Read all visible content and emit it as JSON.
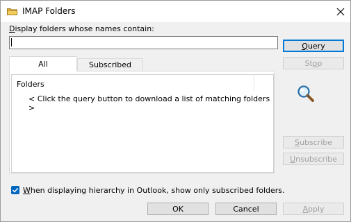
{
  "window": {
    "title": "IMAP Folders",
    "close_label": "×"
  },
  "filter": {
    "label_mnemonic": "D",
    "label_rest": "isplay folders whose names contain:",
    "value": ""
  },
  "tabs": [
    {
      "label": "All",
      "selected": true
    },
    {
      "label": "Subscribed",
      "selected": false
    }
  ],
  "list": {
    "column_header": "Folders",
    "message": "< Click the query button to download a list of matching folders >"
  },
  "buttons": {
    "query": {
      "mnemonic": "Q",
      "rest": "uery",
      "enabled": true
    },
    "stop": {
      "pre": "St",
      "mnemonic": "o",
      "rest": "p",
      "enabled": false
    },
    "subscribe": {
      "mnemonic": "S",
      "rest": "ubscribe",
      "enabled": false
    },
    "unsubscribe": {
      "mnemonic": "U",
      "rest": "nsubscribe",
      "enabled": false
    },
    "ok": {
      "label": "OK",
      "enabled": true
    },
    "cancel": {
      "label": "Cancel",
      "enabled": true
    },
    "apply": {
      "mnemonic": "A",
      "rest": "pply",
      "enabled": false
    }
  },
  "option": {
    "checked": true,
    "label_mnemonic": "W",
    "label_rest": "hen displaying hierarchy in Outlook, show only subscribed folders."
  },
  "colors": {
    "accent": "#0078d7",
    "checkbox_fill": "#0067c0",
    "folder_icon": "#e8b84a"
  },
  "icons": {
    "title": "folder-icon",
    "close": "close-icon",
    "search": "magnifier-icon",
    "check": "checkmark-icon"
  }
}
